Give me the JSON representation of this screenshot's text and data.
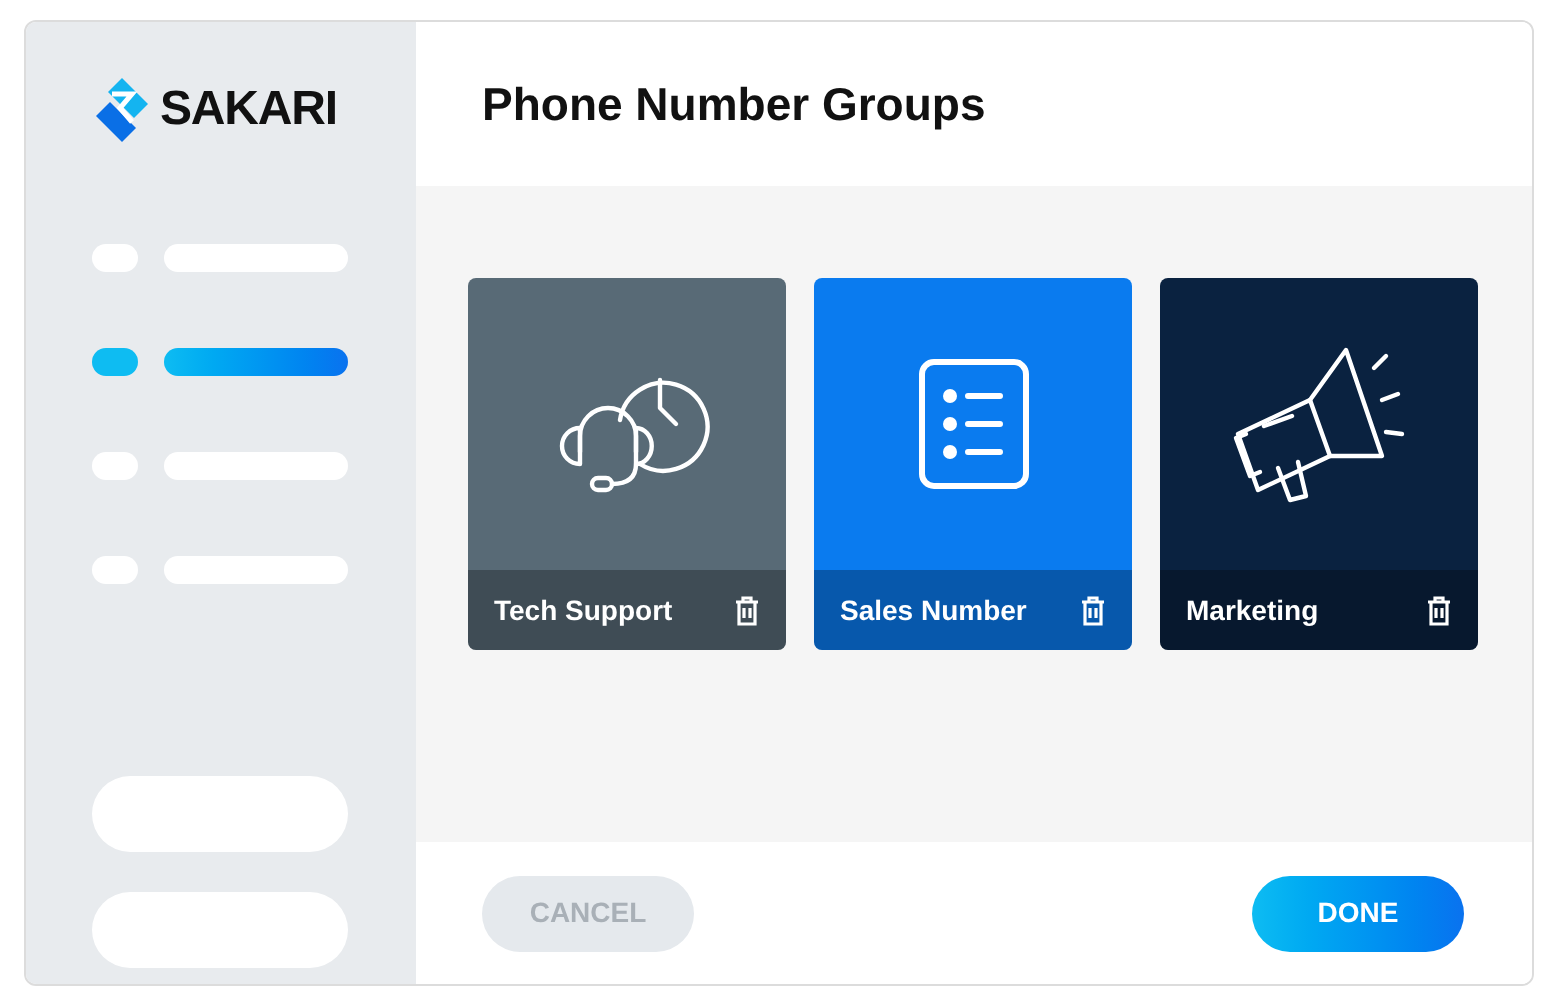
{
  "logo": {
    "text": "SAKARI"
  },
  "sidebar": {
    "items": [
      {
        "selected": false
      },
      {
        "selected": true
      },
      {
        "selected": false
      },
      {
        "selected": false
      }
    ]
  },
  "header": {
    "title": "Phone Number Groups"
  },
  "groups": [
    {
      "name": "Tech Support",
      "kind": "support",
      "color": "#586a76"
    },
    {
      "name": "Sales Number",
      "kind": "list",
      "color": "#0a7bef"
    },
    {
      "name": "Marketing",
      "kind": "megaphone",
      "color": "#0a2240"
    }
  ],
  "footer": {
    "cancel": {
      "label": "CANCEL",
      "disabled": true
    },
    "done": {
      "label": "DONE"
    }
  }
}
